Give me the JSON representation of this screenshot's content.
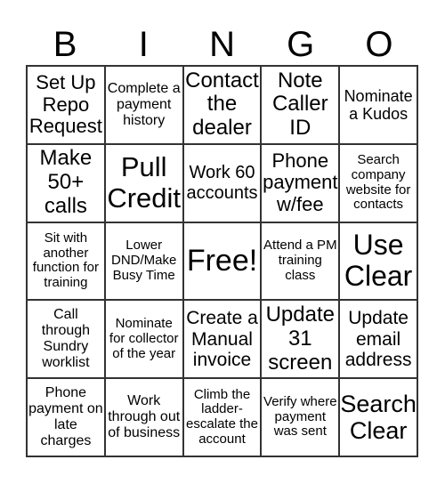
{
  "header": [
    "B",
    "I",
    "N",
    "G",
    "O"
  ],
  "cells": [
    "Set Up Repo Request",
    "Complete a payment history",
    "Contact the dealer",
    "Note Caller ID",
    "Nominate a Kudos",
    "Make 50+ calls",
    "Pull Credit",
    "Work 60 accounts",
    "Phone payment w/fee",
    "Search company website for contacts",
    "Sit with another function for training",
    "Lower DND/Make Busy Time",
    "Free!",
    "Attend a PM training class",
    "Use Clear",
    "Call through Sundry worklist",
    "Nominate for collector of the year",
    "Create a Manual invoice",
    "Update 31 screen",
    "Update email address",
    "Phone payment on late charges",
    "Work through out of business",
    "Climb the ladder-escalate the account",
    "Verify where payment was sent",
    "Search Clear"
  ]
}
